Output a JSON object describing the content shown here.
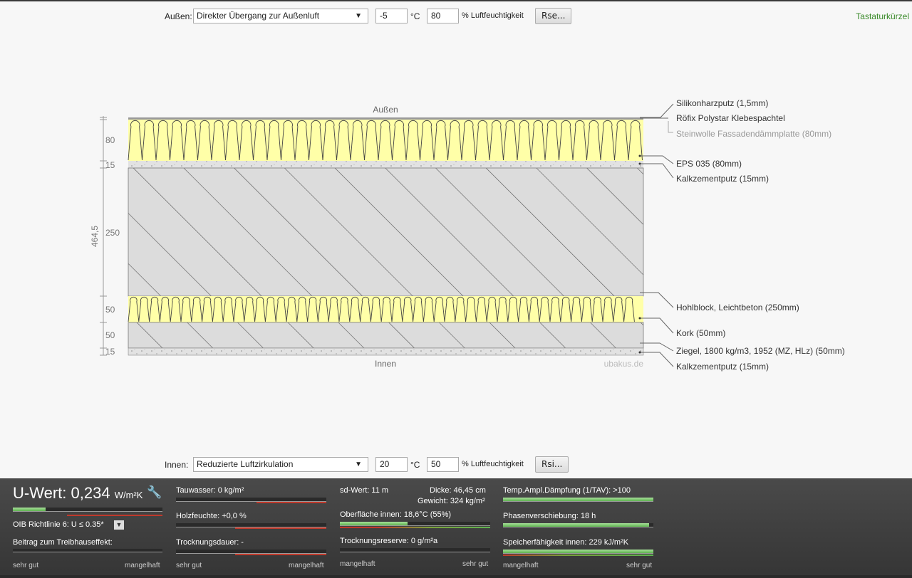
{
  "outside": {
    "label": "Außen:",
    "condition": "Direkter Übergang zur Außenluft",
    "temperature": "-5",
    "temp_unit": "°C",
    "humidity": "80",
    "humidity_label": "% Luftfeuchtigkeit",
    "button": "Rse..."
  },
  "inside": {
    "label": "Innen:",
    "condition": "Reduzierte Luftzirkulation",
    "temperature": "20",
    "temp_unit": "°C",
    "humidity": "50",
    "humidity_label": "% Luftfeuchtigkeit",
    "button": "Rsi..."
  },
  "shortcut_link": "Tastaturkürzel",
  "diagram": {
    "top_label": "Außen",
    "bottom_label": "Innen",
    "watermark": "ubakus.de",
    "total_thickness": "464,5",
    "dims": [
      "80",
      "15",
      "250",
      "50",
      "50",
      "15"
    ],
    "layer_labels": [
      "Silikonharzputz (1,5mm)",
      "Röfix Polystar Klebespachtel",
      "Steinwolle Fassadendämmplatte (80mm)",
      "EPS 035 (80mm)",
      "Kalkzementputz (15mm)",
      "Hohlblock, Leichtbeton (250mm)",
      "Kork (50mm)",
      "Ziegel, 1800 kg/m3, 1952 (MZ, HLz) (50mm)",
      "Kalkzementputz (15mm)"
    ],
    "colors": {
      "insulation": "#ffffa8",
      "masonry": "#dcdcdc",
      "plaster": "#e2e2e2",
      "hatch": "#555555"
    }
  },
  "results": {
    "u_value": {
      "label": "U-Wert:",
      "value": "0,234",
      "unit": "W/m²K",
      "bar": 0.22,
      "oib": "OIB Richtlinie 6: U ≤ 0.35*",
      "greenhouse": "Beitrag zum Treibhauseffekt:",
      "scale_left": "sehr gut",
      "scale_right": "mangelhaft"
    },
    "col2": {
      "tauwasser": "Tauwasser: 0 kg/m²",
      "holzfeuchte": "Holzfeuchte: +0,0 %",
      "trocknungsdauer": "Trocknungsdauer: -",
      "scale_left": "sehr gut",
      "scale_right": "mangelhaft"
    },
    "col3": {
      "sd": "sd-Wert: 11 m",
      "dicke": "Dicke: 46,45 cm",
      "gewicht": "Gewicht: 324 kg/m²",
      "oberflaeche": "Oberfläche innen: 18,6°C (55%)",
      "oberflaeche_bar": 0.45,
      "reserve": "Trocknungsreserve: 0 g/m²a",
      "scale_left": "mangelhaft",
      "scale_right": "sehr gut"
    },
    "col4": {
      "tav": "Temp.Ampl.Dämpfung (1/TAV): >100",
      "tav_bar": 1.0,
      "phase": "Phasenverschiebung: 18 h",
      "phase_bar": 0.97,
      "speicher": "Speicherfähigkeit innen: 229 kJ/m²K",
      "speicher_bar": 1.0,
      "scale_left": "mangelhaft",
      "scale_right": "sehr gut"
    }
  }
}
